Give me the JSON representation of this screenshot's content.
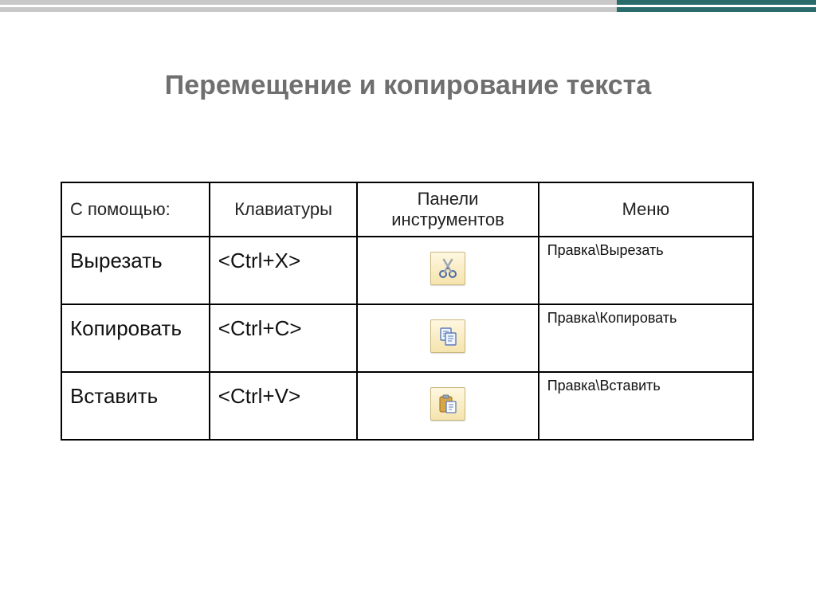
{
  "title": "Перемещение и копирование текста",
  "table": {
    "header": {
      "with_label": "С помощью:",
      "keyboard": "Клавиатуры",
      "toolbar": "Панели инструментов",
      "menu": "Меню"
    },
    "rows": [
      {
        "action": "Вырезать",
        "shortcut": "<Ctrl+X>",
        "icon": "cut",
        "menu_path": "Правка\\Вырезать"
      },
      {
        "action": "Копировать",
        "shortcut": "<Ctrl+C>",
        "icon": "copy",
        "menu_path": "Правка\\Копировать"
      },
      {
        "action": "Вставить",
        "shortcut": "<Ctrl+V>",
        "icon": "paste",
        "menu_path": "Правка\\Вставить"
      }
    ]
  }
}
